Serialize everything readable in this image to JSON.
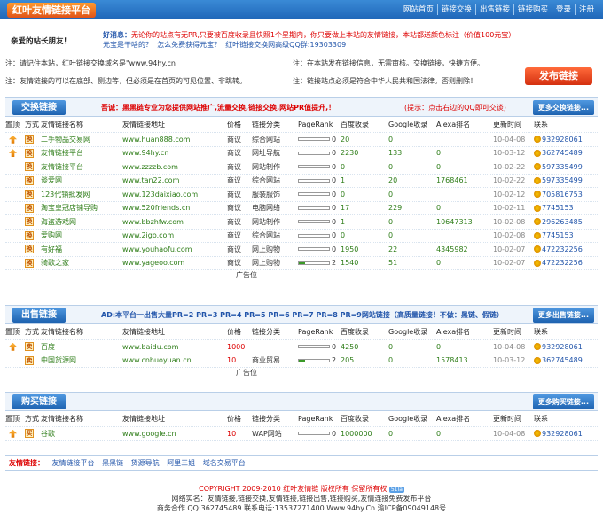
{
  "header": {
    "logo": "红叶友情链接平台",
    "nav": [
      "网站首页",
      "链接交换",
      "出售链接",
      "链接购买",
      "登录",
      "注册"
    ]
  },
  "greeting": "亲爱的站长朋友！",
  "news": {
    "label": "好消息：",
    "line1": "无论你的站点有无PR,只要被百度收录且快照1个星期内，你只要做上本站的友情链接，本站都送颜色标注（价值100元宝）",
    "line2a": "元宝是干啥的？",
    "line2b": "怎么免费获得元宝？",
    "line2c": "红叶链接交换网高级QQ群:19303309"
  },
  "notices": {
    "n1": "注：请记住本站，红叶链接交换域名是\"www.94hy.cn",
    "n2": "注：在本站发布链接信息，无需审核。交换链接，快捷方便。",
    "n3": "注：友情链接的可以在底部、侧边等，但必须是在首页的可见位置、非跳转。",
    "n4": "注：链接站点必须是符合中华人民共和国法律。否则删除！",
    "publish": "发布链接"
  },
  "exchange": {
    "title": "交换链接",
    "desc": "吾诚：黑黑链专业为您提供网站推广,流量交换,链接交换,网站PR值提升,！",
    "desc2": "(提示：点击右边的QQ即可交谈)",
    "more": "更多交换链接...",
    "headers": [
      "置顶",
      "方式",
      "友情链接名称",
      "友情链接地址",
      "价格",
      "链接分类",
      "PageRank",
      "百度收录",
      "Google收录",
      "Alexa排名",
      "更新时间",
      "联系"
    ],
    "rows": [
      {
        "mode": "换",
        "name": "二手物品交易网",
        "url": "www.huan888.com",
        "price": "商议",
        "cat": "综合网站",
        "pr": "0",
        "baidu": "20",
        "google": "0",
        "alexa": "",
        "date": "10-04-08",
        "qq": "932928061",
        "top": true
      },
      {
        "mode": "换",
        "name": "友情链接平台",
        "url": "www.94hy.cn",
        "price": "商议",
        "cat": "网址导航",
        "pr": "0",
        "baidu": "2230",
        "google": "133",
        "alexa": "0",
        "date": "10-03-12",
        "qq": "362745489",
        "top": true
      },
      {
        "mode": "换",
        "name": "友情链接平台",
        "url": "www.zzzzb.com",
        "price": "商议",
        "cat": "网站制作",
        "pr": "0",
        "baidu": "0",
        "google": "0",
        "alexa": "0",
        "date": "10-02-22",
        "qq": "597335499",
        "top": false
      },
      {
        "mode": "换",
        "name": "谈爱网",
        "url": "www.tan22.com",
        "price": "商议",
        "cat": "综合网站",
        "pr": "0",
        "baidu": "1",
        "google": "20",
        "alexa": "1768461",
        "date": "10-02-22",
        "qq": "597335499",
        "top": false
      },
      {
        "mode": "换",
        "name": "123代销批发网",
        "url": "www.123daixiao.com",
        "price": "商议",
        "cat": "服装服饰",
        "pr": "0",
        "baidu": "0",
        "google": "0",
        "alexa": "",
        "date": "10-02-12",
        "qq": "705816753",
        "top": false
      },
      {
        "mode": "换",
        "name": "淘宝皇冠店铺导购",
        "url": "www.520friends.cn",
        "price": "商议",
        "cat": "电脑网络",
        "pr": "0",
        "baidu": "17",
        "google": "229",
        "alexa": "0",
        "date": "10-02-11",
        "qq": "7745153",
        "top": false
      },
      {
        "mode": "换",
        "name": "海盗游戏网",
        "url": "www.bbzhfw.com",
        "price": "商议",
        "cat": "网站制作",
        "pr": "0",
        "baidu": "1",
        "google": "0",
        "alexa": "10647313",
        "date": "10-02-08",
        "qq": "296263485",
        "top": false
      },
      {
        "mode": "换",
        "name": "爱购网",
        "url": "www.2igo.com",
        "price": "商议",
        "cat": "综合网站",
        "pr": "0",
        "baidu": "0",
        "google": "0",
        "alexa": "",
        "date": "10-02-08",
        "qq": "7745153",
        "top": false
      },
      {
        "mode": "换",
        "name": "有好福",
        "url": "www.youhaofu.com",
        "price": "商议",
        "cat": "网上购物",
        "pr": "0",
        "baidu": "1950",
        "google": "22",
        "alexa": "4345982",
        "date": "10-02-07",
        "qq": "472232256",
        "top": false
      },
      {
        "mode": "换",
        "name": "骑歌之家",
        "url": "www.yageoo.com",
        "price": "商议",
        "cat": "网上购物",
        "pr": "2",
        "baidu": "1540",
        "google": "51",
        "alexa": "0",
        "date": "10-02-07",
        "qq": "472232256",
        "top": false
      }
    ],
    "adspot": "广告位"
  },
  "sell": {
    "title": "出售链接",
    "desc": "AD:本平台一出售大量PR=2 PR=3 PR=4 PR=5 PR=6 PR=7 PR=8 PR=9网站链接（高质量链接！不做：黑链、假链）",
    "more": "更多出售链接...",
    "headers": [
      "置顶",
      "方式",
      "友情链接名称",
      "友情链接地址",
      "价格",
      "链接分类",
      "PageRank",
      "百度收录",
      "Google收录",
      "Alexa排名",
      "更新时间",
      "联系"
    ],
    "rows": [
      {
        "mode": "卖",
        "name": "百度",
        "url": "www.baidu.com",
        "price": "1000",
        "cat": "",
        "pr": "0",
        "baidu": "4250",
        "google": "0",
        "alexa": "0",
        "date": "10-04-08",
        "qq": "932928061",
        "top": true
      },
      {
        "mode": "卖",
        "name": "中国货源网",
        "url": "www.cnhuoyuan.cn",
        "price": "10",
        "cat": "商业贸易",
        "pr": "2",
        "baidu": "205",
        "google": "0",
        "alexa": "1578413",
        "date": "10-03-12",
        "qq": "362745489",
        "top": false
      }
    ],
    "adspot": "广告位"
  },
  "buy": {
    "title": "购买链接",
    "more": "更多购买链接...",
    "headers": [
      "置顶",
      "方式",
      "友情链接名称",
      "友情链接地址",
      "价格",
      "链接分类",
      "PageRank",
      "百度收录",
      "Google收录",
      "Alexa排名",
      "更新时间",
      "联系"
    ],
    "rows": [
      {
        "mode": "买",
        "name": "谷歌",
        "url": "www.google.cn",
        "price": "10",
        "cat": "WAP网站",
        "pr": "0",
        "baidu": "1000000",
        "google": "0",
        "alexa": "0",
        "date": "10-04-08",
        "qq": "932928061",
        "top": true
      }
    ]
  },
  "footer": {
    "links_label": "友情链接：",
    "links": [
      "友情链接平台",
      "黑黑链",
      "货源导航",
      "阿里三姐",
      "域名交易平台"
    ],
    "copyright": "COPYRIGHT 2009-2010 红叶友情链 版权所有 保留所有权",
    "badge": "51la",
    "line2": "网络实名：友情链接,链接交换,友情链接,链接出售,链接购买,友情连接免费发布平台",
    "line3": "商务合作 QQ:362745489 联系电话:13537271400 Www.94hy.Cn 渝ICP备09049148号"
  },
  "colors": {
    "brand_blue": "#1f66b8",
    "accent_red": "#d00000",
    "link_green": "#2e7d18"
  }
}
